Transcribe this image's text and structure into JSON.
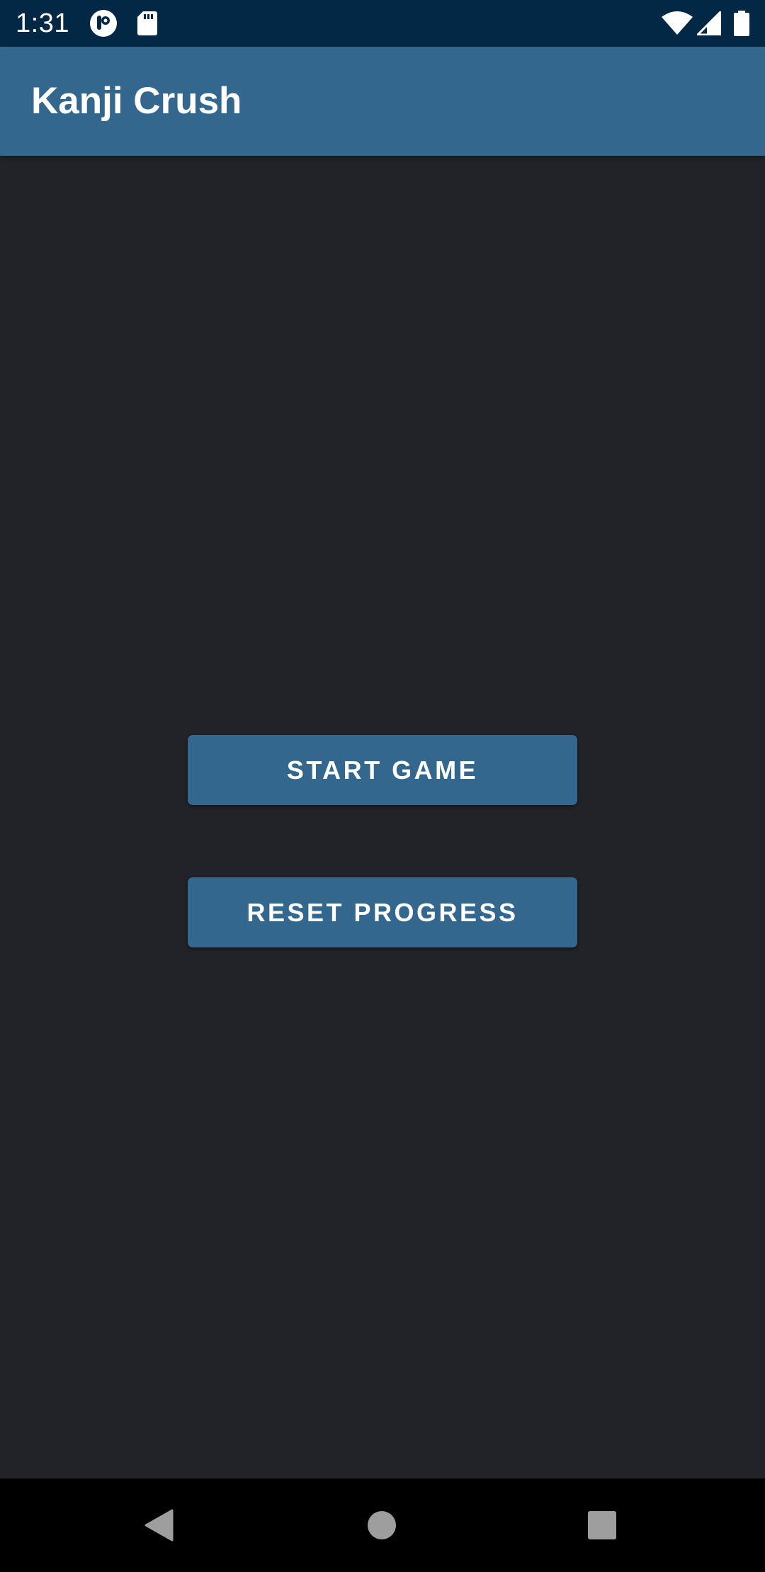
{
  "status_bar": {
    "time": "1:31",
    "notification_icons": [
      "app-notification-icon",
      "sd-card-icon"
    ],
    "system_icons": [
      "wifi-icon",
      "cellular-signal-icon",
      "battery-icon"
    ],
    "background_color": "#022846"
  },
  "app_bar": {
    "title": "Kanji Crush",
    "background_color": "#34678d"
  },
  "main": {
    "background_color": "#222328",
    "buttons": [
      {
        "label": "START GAME"
      },
      {
        "label": "RESET PROGRESS"
      }
    ]
  },
  "nav_bar": {
    "icons": [
      "back-icon",
      "home-icon",
      "recents-icon"
    ]
  }
}
